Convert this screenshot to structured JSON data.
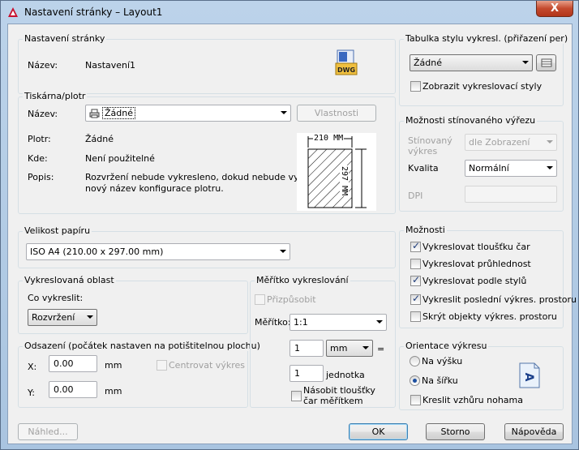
{
  "window": {
    "title": "Nastavení stránky – Layout1",
    "close_label": "X"
  },
  "page_setup": {
    "title": "Nastavení stránky",
    "name_label": "Název:",
    "name_value": "Nastavení1",
    "dwg_icon_text": "DWG"
  },
  "plotter": {
    "title": "Tiskárna/plotr",
    "name_label": "Název:",
    "name_value": "Žádné",
    "properties_button": "Vlastnosti",
    "plotter_label": "Plotr:",
    "plotter_value": "Žádné",
    "where_label": "Kde:",
    "where_value": "Není použitelné",
    "desc_label": "Popis:",
    "desc_line1": "Rozvržení nebude vykresleno, dokud nebude vybrán",
    "desc_line2": "nový název konfigurace plotru.",
    "preview_width": "210 MM",
    "preview_height": "297 MM"
  },
  "paper_size": {
    "title": "Velikost papíru",
    "value": "ISO A4 (210.00 x 297.00 mm)"
  },
  "plot_area": {
    "title": "Vykreslovaná oblast",
    "what_label": "Co vykreslit:",
    "what_value": "Rozvržení"
  },
  "offset": {
    "title": "Odsazení (počátek nastaven na potištitelnou plochu)",
    "x_label": "X:",
    "x_value": "0.00",
    "x_unit": "mm",
    "y_label": "Y:",
    "y_value": "0.00",
    "y_unit": "mm",
    "center_label": "Centrovat výkres"
  },
  "scale": {
    "title": "Měřítko vykreslování",
    "fit_label": "Přizpůsobit",
    "scale_label": "Měřítko:",
    "scale_value": "1:1",
    "num_value": "1",
    "unit_value": "mm",
    "equals": "=",
    "den_value": "1",
    "den_unit": "jednotka",
    "lineweights_line1": "Násobit tloušťky",
    "lineweights_line2": "čar měřítkem"
  },
  "plot_style": {
    "title": "Tabulka stylu vykresl. (přiřazení per)",
    "value": "Žádné",
    "show_label": "Zobrazit vykreslovací styly"
  },
  "shaded": {
    "title": "Možnosti stínovaného výřezu",
    "shade_label_line1": "Stínovaný",
    "shade_label_line2": "výkres",
    "shade_value": "dle Zobrazení",
    "quality_label": "Kvalita",
    "quality_value": "Normální",
    "dpi_label": "DPI"
  },
  "options": {
    "title": "Možnosti",
    "items": [
      {
        "label": "Vykreslovat tloušťku čar",
        "checked": true
      },
      {
        "label": "Vykreslovat průhlednost",
        "checked": false
      },
      {
        "label": "Vykreslovat podle stylů",
        "checked": true
      },
      {
        "label": "Vykreslit poslední výkres. prostoru",
        "checked": true
      },
      {
        "label": "Skrýt objekty výkres. prostoru",
        "checked": false
      }
    ]
  },
  "orientation": {
    "title": "Orientace výkresu",
    "portrait_label": "Na výšku",
    "landscape_label": "Na šířku",
    "upside_label": "Kreslit vzhůru nohama",
    "icon_letter": "A"
  },
  "buttons": {
    "preview": "Náhled...",
    "ok": "OK",
    "cancel": "Storno",
    "help": "Nápověda"
  }
}
